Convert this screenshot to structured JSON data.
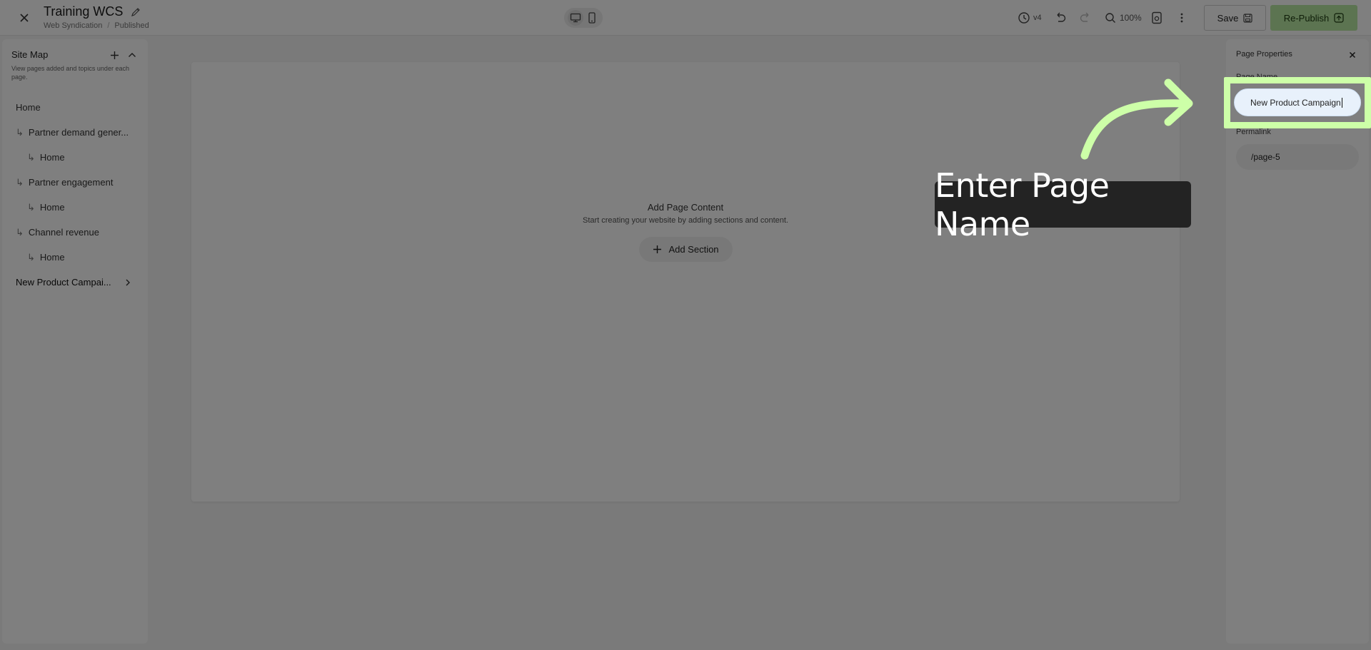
{
  "header": {
    "title": "Training WCS",
    "breadcrumb": [
      "Web Syndication",
      "Published"
    ],
    "breadcrumb_separator": "/",
    "version": "v4",
    "zoom": "100%",
    "save_label": "Save",
    "republish_label": "Re-Publish"
  },
  "sidebar": {
    "title": "Site Map",
    "description": "View pages added and topics under each page.",
    "items": [
      {
        "label": "Home",
        "level": 0
      },
      {
        "label": "Partner demand gener...",
        "level": 1
      },
      {
        "label": "Home",
        "level": 2
      },
      {
        "label": "Partner engagement",
        "level": 1
      },
      {
        "label": "Home",
        "level": 2
      },
      {
        "label": "Channel revenue",
        "level": 1
      },
      {
        "label": "Home",
        "level": 2
      },
      {
        "label": "New Product Campai...",
        "level": 0,
        "active": true
      }
    ]
  },
  "canvas": {
    "empty_title": "Add Page Content",
    "empty_subtitle": "Start creating your website by adding sections and content.",
    "add_section_label": "Add Section"
  },
  "properties": {
    "title": "Page Properties",
    "page_name_label": "Page Name",
    "page_name_value": "New Product Campaign",
    "permalink_label": "Permalink",
    "permalink_value": "/page-5"
  },
  "tutorial": {
    "tooltip": "Enter Page Name",
    "highlight_color": "#cdffa8"
  },
  "colors": {
    "accent_green": "#b9e8a2",
    "input_focus_bg": "#e8f1fb"
  }
}
